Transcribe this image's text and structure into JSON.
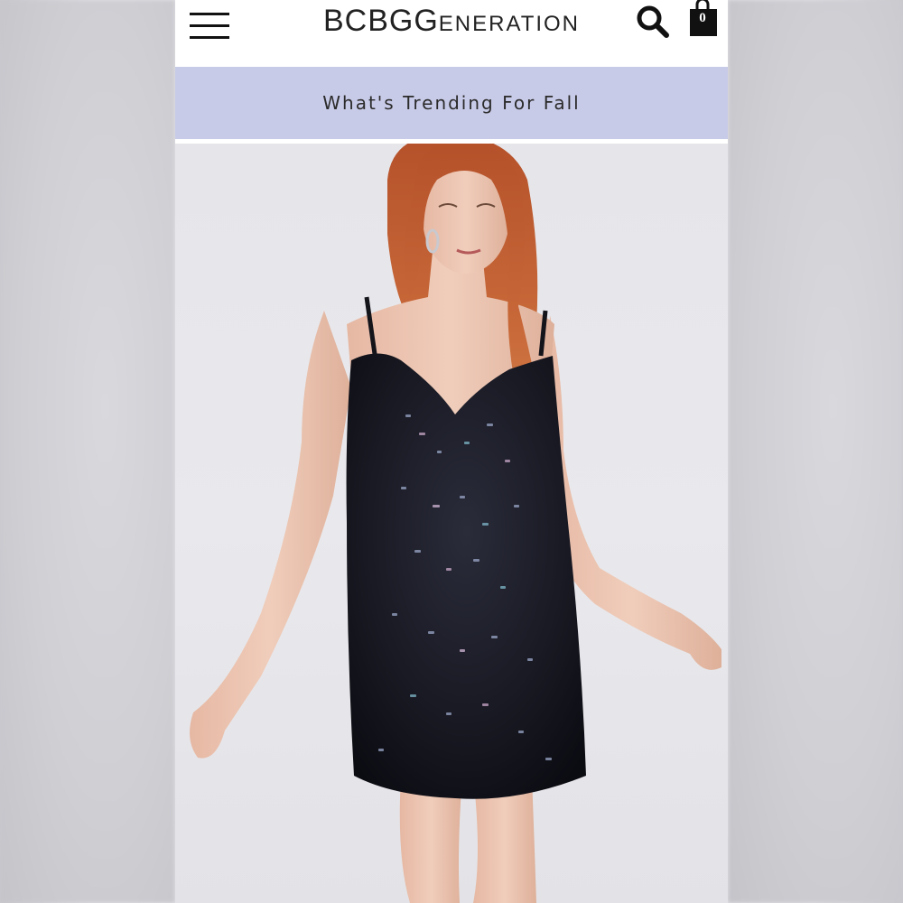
{
  "header": {
    "logo": {
      "prefix": "BCBG",
      "suffix": "ENERATION",
      "cap": "G"
    },
    "cart_count": "0"
  },
  "promo": {
    "text": "What's Trending For Fall"
  },
  "hero": {
    "alt": "model-in-sequin-slip-dress"
  },
  "colors": {
    "promo_bg": "#c8cbe8",
    "header_bg": "#ffffff",
    "icon": "#111111"
  },
  "icons": [
    "menu-icon",
    "search-icon",
    "shopping-bag-icon"
  ]
}
